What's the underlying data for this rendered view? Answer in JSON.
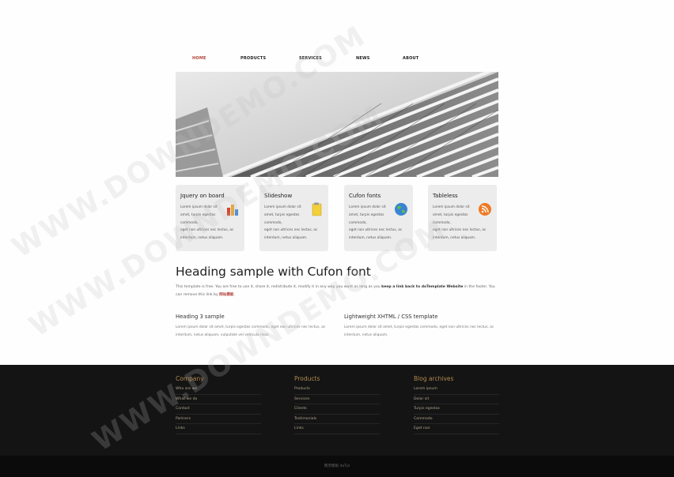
{
  "nav": {
    "items": [
      {
        "label": "HOME",
        "active": true
      },
      {
        "label": "PRODUCTS",
        "active": false
      },
      {
        "label": "SERVICES",
        "active": false
      },
      {
        "label": "NEWS",
        "active": false
      },
      {
        "label": "ABOUT",
        "active": false
      }
    ]
  },
  "features": [
    {
      "title": "Jquery on board",
      "icon": "bar-chart-icon",
      "text_a": "Lorem ipsum dolor sit amet, turpis egestas commodo,",
      "text_b": "eget non ultrices nec lectus, ac interdum, netus aliquam."
    },
    {
      "title": "Slideshow",
      "icon": "sticky-note-icon",
      "text_a": "Lorem ipsum dolor sit amet, turpis egestas commodo,",
      "text_b": "eget non ultrices nec lectus, ac interdum, netus aliquam."
    },
    {
      "title": "Cufon fonts",
      "icon": "globe-icon",
      "text_a": "Lorem ipsum dolor sit amet, turpis egestas commodo,",
      "text_b": "eget non ultrices nec lectus, ac interdum, netus aliquam."
    },
    {
      "title": "Tableless",
      "icon": "rss-icon",
      "text_a": "Lorem ipsum dolor sit amet, turpis egestas commodo,",
      "text_b": "eget non ultrices nec lectus, ac interdum, netus aliquam."
    }
  ],
  "main": {
    "heading": "Heading sample with Cufon font",
    "intro_a": "This template is free. You are free to use it, share it, redistribute it, modify it in any way you want as long as you ",
    "intro_bold": "keep a link back to doTemplate Website",
    "intro_b": " in the footer. You can remove this link by ",
    "intro_link": "网站模板",
    "intro_end": ".",
    "col1_title": "Heading 3 sample",
    "col1_text": "Lorem ipsum dolor sit amet, turpis egestas commodo, eget non ultrices nec lectus, ac interdum, netus aliquam, vulputate vel vehicula risus.",
    "col2_title": "Lightweight XHTML / CSS template",
    "col2_text": "Lorem ipsum dolor sit amet, turpis egestas commodo, eget non ultrices nec lectus, ac interdum, netus aliquam."
  },
  "footer": {
    "columns": [
      {
        "title": "Company",
        "links": [
          "Who are we",
          "What we do",
          "Contact",
          "Partners",
          "Links"
        ]
      },
      {
        "title": "Products",
        "links": [
          "Products",
          "Services",
          "Clients",
          "Testimonials",
          "Links"
        ]
      },
      {
        "title": "Blog archives",
        "links": [
          "Lorem ipsum",
          "Dolor sit",
          "Turpis egestas",
          "Commodo",
          "Eget non"
        ]
      }
    ],
    "copyright": "网页模板 doTpl"
  },
  "watermark": "WWW.DOWNDEMO.COM",
  "colors": {
    "accent": "#b3423a",
    "footer_bg": "#141414",
    "footer_title": "#b08a4e"
  }
}
